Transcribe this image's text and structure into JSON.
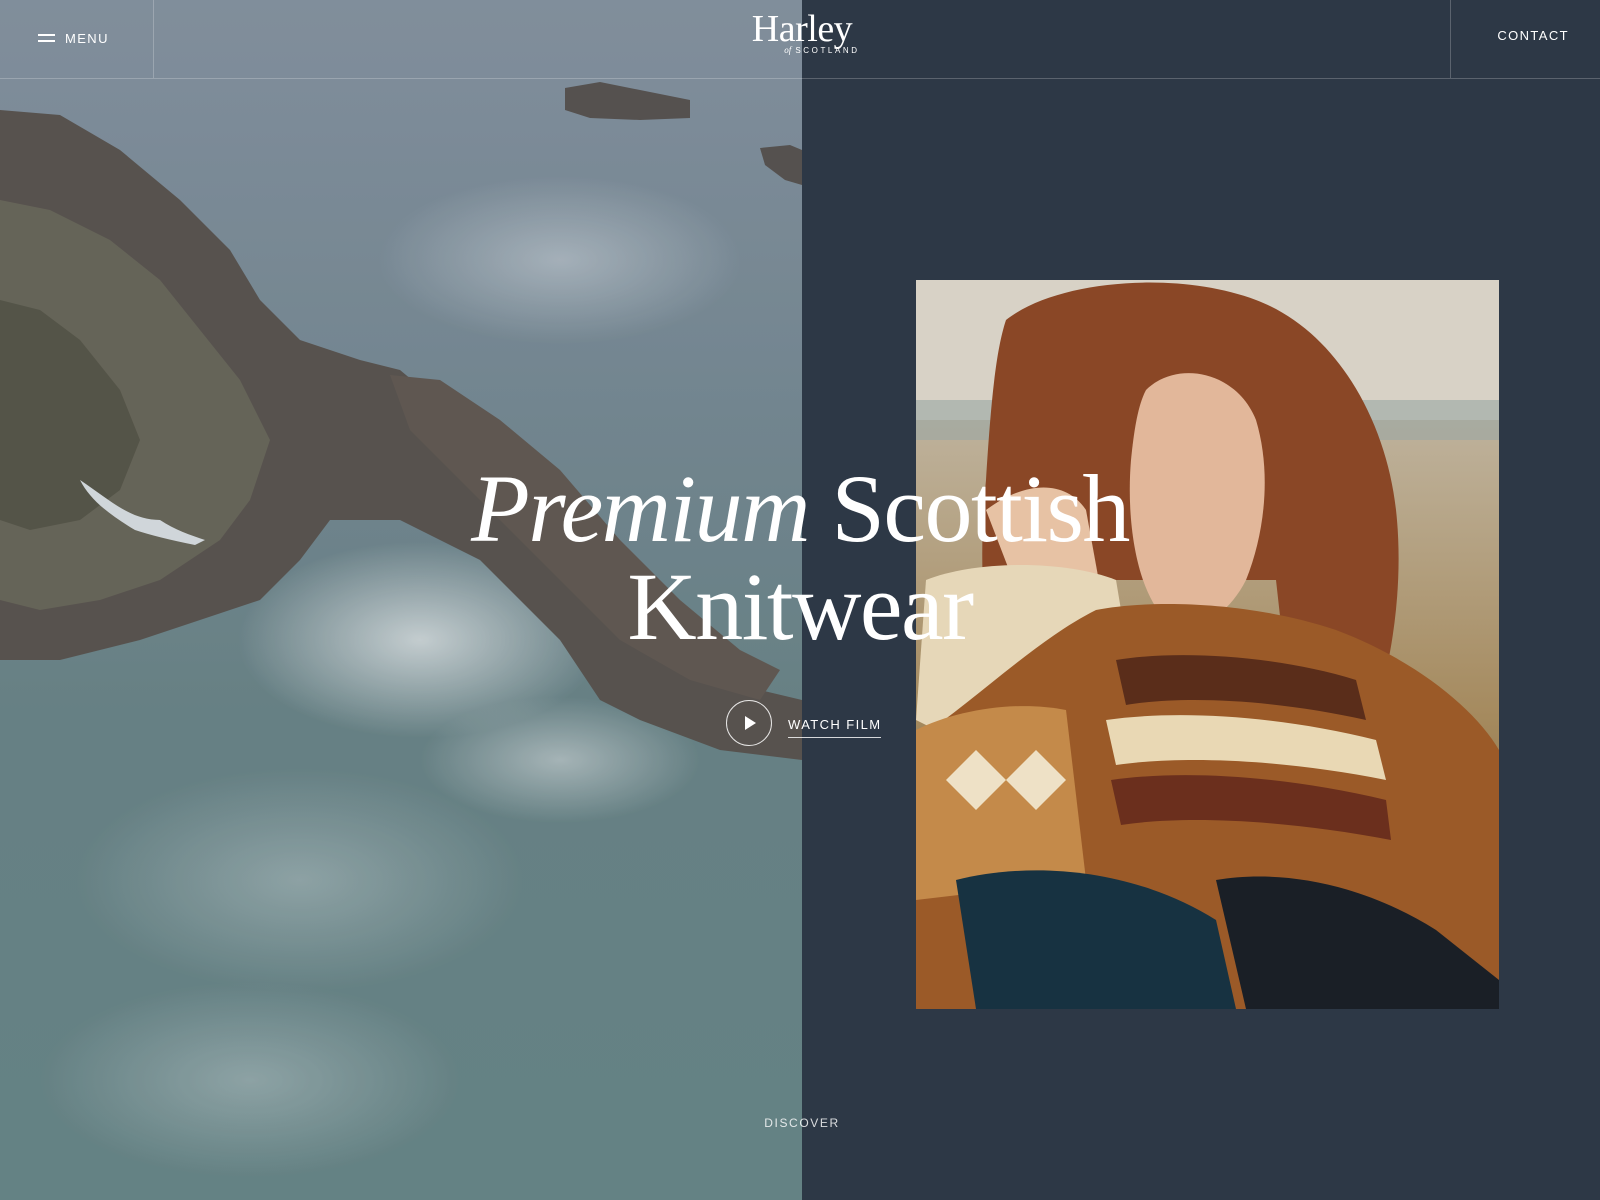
{
  "header": {
    "menu_label": "MENU",
    "logo_word": "Harley",
    "logo_of": "of",
    "logo_sub": "SCOTLAND",
    "contact_label": "CONTACT"
  },
  "hero": {
    "title_italic": "Premium",
    "title_rest": "Scottish",
    "title_line2": "Knitwear",
    "watch_label": "WATCH FILM"
  },
  "footer": {
    "discover_label": "DISCOVER"
  },
  "colors": {
    "panel": "#2d3846",
    "text": "#ffffff"
  },
  "icons": [
    "menu-icon",
    "play-icon"
  ]
}
